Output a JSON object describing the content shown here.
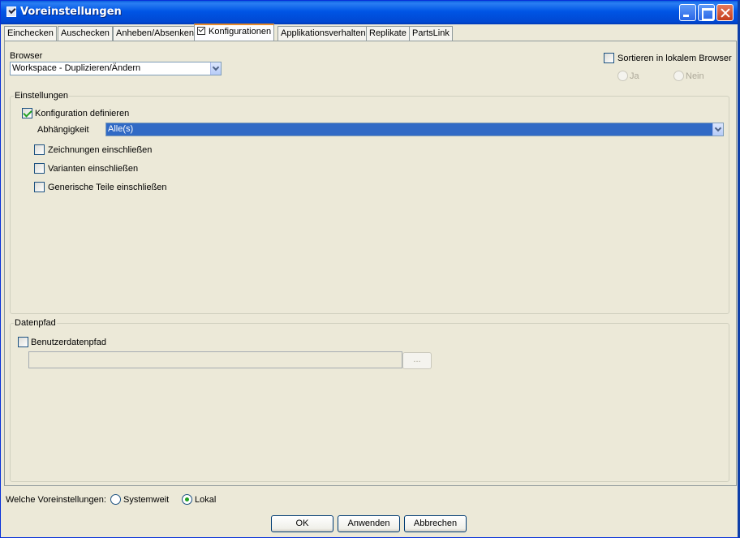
{
  "window": {
    "title": "Voreinstellungen"
  },
  "tabs": [
    {
      "label": "Einchecken"
    },
    {
      "label": "Auschecken"
    },
    {
      "label": "Anheben/Absenken"
    },
    {
      "label": "Konfigurationen"
    },
    {
      "label": "Applikationsverhalten"
    },
    {
      "label": "Replikate"
    },
    {
      "label": "PartsLink"
    }
  ],
  "active_tab": "Konfigurationen",
  "browser": {
    "label": "Browser",
    "selected": "Workspace - Duplizieren/Ändern",
    "sort_local_label": "Sortieren in lokalem Browser",
    "sort_local_checked": false,
    "radio_yes_label": "Ja",
    "radio_no_label": "Nein"
  },
  "einstellungen": {
    "title": "Einstellungen",
    "define_config_label": "Konfiguration definieren",
    "define_config_checked": true,
    "dependency_label": "Abhängigkeit",
    "dependency_value": "Alle(s)",
    "options": [
      {
        "label": "Zeichnungen einschließen",
        "checked": false
      },
      {
        "label": "Varianten einschließen",
        "checked": false
      },
      {
        "label": "Generische Teile einschließen",
        "checked": false
      }
    ]
  },
  "datenpfad": {
    "title": "Datenpfad",
    "user_path_label": "Benutzerdatenpfad",
    "user_path_checked": false,
    "path_value": "",
    "browse_label": "..."
  },
  "footer": {
    "scope_label": "Welche Voreinstellungen:",
    "system_label": "Systemweit",
    "local_label": "Lokal",
    "selected_scope": "Lokal",
    "ok_label": "OK",
    "apply_label": "Anwenden",
    "cancel_label": "Abbrechen"
  },
  "colors": {
    "title_bar": "#0055e5",
    "selection": "#316ac5",
    "checkmark": "#21a121",
    "dialog_bg": "#ece9d8"
  }
}
